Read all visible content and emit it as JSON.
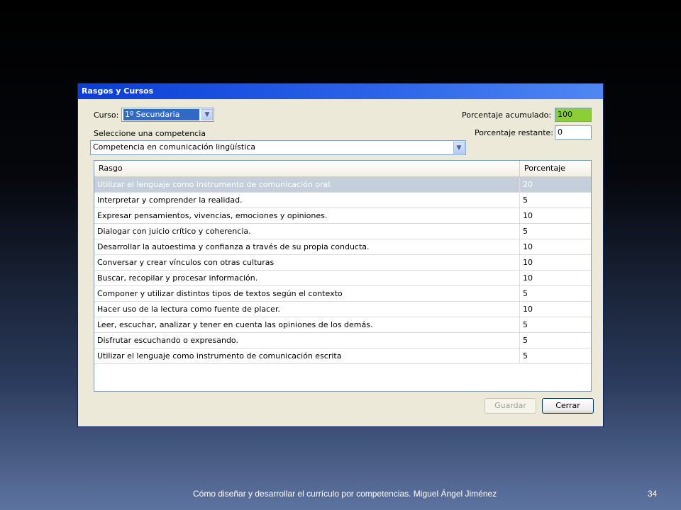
{
  "window": {
    "title": "Rasgos y Cursos"
  },
  "curso": {
    "label": "Curso:",
    "value": "1º Secundaria"
  },
  "competencia": {
    "label": "Seleccione una competencia",
    "value": "Competencia en comunicación lingüística"
  },
  "porcentaje_acumulado": {
    "label": "Porcentaje acumulado:",
    "value": "100",
    "color": "#8ccf35"
  },
  "porcentaje_restante": {
    "label": "Porcentaje restante:",
    "value": "0"
  },
  "grid": {
    "columns": [
      "Rasgo",
      "Porcentaje"
    ],
    "selected_row": 0,
    "rows": [
      {
        "rasgo": "Utilizar el lenguaje como instrumento de comunicación oral.",
        "porcentaje": "20"
      },
      {
        "rasgo": "Interpretar y comprender la realidad.",
        "porcentaje": "5"
      },
      {
        "rasgo": "Expresar pensamientos, vivencias, emociones y opiniones.",
        "porcentaje": "10"
      },
      {
        "rasgo": "Dialogar con juicio crítico y coherencia.",
        "porcentaje": "5"
      },
      {
        "rasgo": "Desarrollar la autoestima y confianza a través de su propia conducta.",
        "porcentaje": "10"
      },
      {
        "rasgo": "Conversar y crear vínculos con otras culturas",
        "porcentaje": "10"
      },
      {
        "rasgo": "Buscar, recopilar y procesar información.",
        "porcentaje": "10"
      },
      {
        "rasgo": "Componer y utilizar distintos tipos de textos según el contexto",
        "porcentaje": "5"
      },
      {
        "rasgo": "Hacer uso de la lectura como fuente de placer.",
        "porcentaje": "10"
      },
      {
        "rasgo": "Leer, escuchar, analizar y tener en cuenta las opiniones de los demás.",
        "porcentaje": "5"
      },
      {
        "rasgo": "Disfrutar escuchando o expresando.",
        "porcentaje": "5"
      },
      {
        "rasgo": "Utilizar el lenguaje como instrumento de comunicación escrita",
        "porcentaje": "5"
      }
    ]
  },
  "buttons": {
    "guardar": "Guardar",
    "cerrar": "Cerrar"
  },
  "slide": {
    "footer": "Cómo diseñar y desarrollar el currículo por competencias. Miguel Ángel Jiménez",
    "page_number": "34"
  }
}
